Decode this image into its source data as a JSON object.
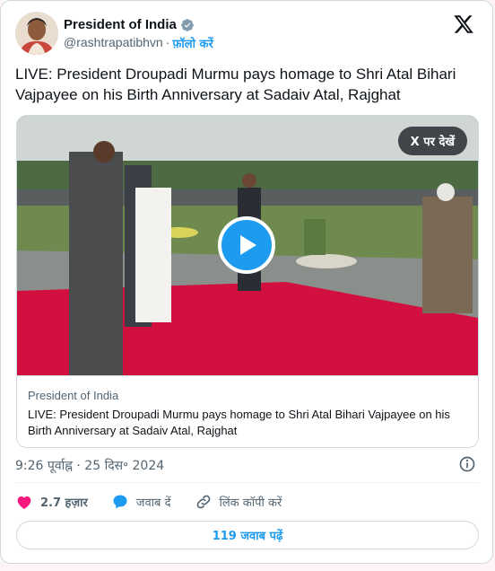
{
  "author": {
    "display_name": "President of India",
    "handle": "@rashtrapatibhvn",
    "separator": "·",
    "follow_label": "फ़ॉलो करें"
  },
  "tweet": {
    "text": "LIVE: President Droupadi Murmu pays homage to Shri Atal Bihari Vajpayee on his Birth Anniversary at Sadaiv Atal, Rajghat",
    "timestamp": "9:26 पूर्वाह्न · 25 दिस॰ 2024"
  },
  "media": {
    "watch_on_x_label": "X पर देखें",
    "card_source": "President of India",
    "card_title": "LIVE: President Droupadi Murmu pays homage to Shri Atal Bihari Vajpayee on his Birth Anniversary at Sadaiv Atal, Rajghat"
  },
  "actions": {
    "like_count": "2.7 हज़ार",
    "reply_label": "जवाब दें",
    "copy_link_label": "लिंक कॉपी करें"
  },
  "replies_button_label": "119 जवाब पढ़ें",
  "colors": {
    "accent": "#1d9bf0",
    "like": "#f91880",
    "text": "#0f1419",
    "muted": "#536471",
    "border": "#cfd9de"
  },
  "icons": [
    "verified-icon",
    "x-logo-icon",
    "play-icon",
    "info-icon",
    "heart-icon",
    "reply-icon",
    "link-icon"
  ]
}
